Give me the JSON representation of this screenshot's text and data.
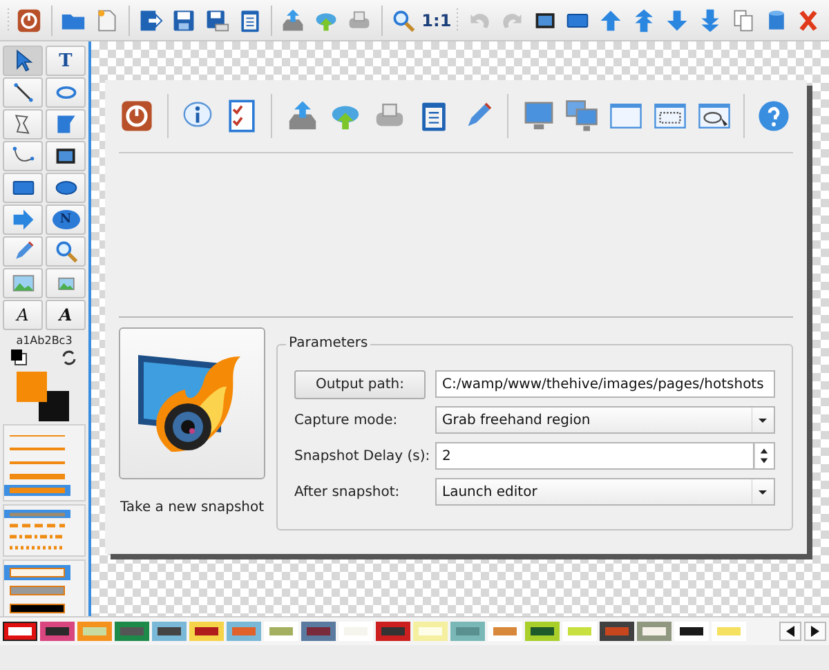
{
  "toolbar": [
    {
      "kind": "grip"
    },
    {
      "kind": "power"
    },
    {
      "kind": "separator"
    },
    {
      "kind": "folder"
    },
    {
      "kind": "new-doc"
    },
    {
      "kind": "separator"
    },
    {
      "kind": "export"
    },
    {
      "kind": "save"
    },
    {
      "kind": "save-as"
    },
    {
      "kind": "clipboard"
    },
    {
      "kind": "separator"
    },
    {
      "kind": "tray-upload"
    },
    {
      "kind": "cloud-upload"
    },
    {
      "kind": "printer"
    },
    {
      "kind": "separator"
    },
    {
      "kind": "zoom"
    },
    {
      "kind": "label",
      "label": "1:1"
    },
    {
      "kind": "grip"
    },
    {
      "kind": "undo",
      "disabled": true
    },
    {
      "kind": "redo",
      "disabled": true
    },
    {
      "kind": "crop"
    },
    {
      "kind": "rect"
    },
    {
      "kind": "up"
    },
    {
      "kind": "up-double"
    },
    {
      "kind": "down"
    },
    {
      "kind": "down-double"
    },
    {
      "kind": "copy"
    },
    {
      "kind": "cylinder"
    },
    {
      "kind": "close"
    }
  ],
  "tools": [
    {
      "kind": "pointer",
      "selected": true
    },
    {
      "kind": "text",
      "label": "T",
      "selected": false
    },
    {
      "kind": "line",
      "selected": false
    },
    {
      "kind": "lasso",
      "selected": false
    },
    {
      "kind": "polygon",
      "selected": false
    },
    {
      "kind": "region",
      "selected": false
    },
    {
      "kind": "curve",
      "selected": false
    },
    {
      "kind": "crop",
      "selected": false
    },
    {
      "kind": "rect",
      "selected": false
    },
    {
      "kind": "ellipse",
      "selected": false
    },
    {
      "kind": "arrow",
      "selected": false
    },
    {
      "kind": "number",
      "label": "N",
      "selected": false
    },
    {
      "kind": "pencil",
      "selected": false
    },
    {
      "kind": "zoom",
      "selected": false
    },
    {
      "kind": "image",
      "selected": false
    },
    {
      "kind": "image-small",
      "selected": false
    },
    {
      "kind": "font",
      "label": "A",
      "selected": false
    },
    {
      "kind": "font-bold",
      "label": "A",
      "selected": false
    }
  ],
  "font_sample": "a1Ab2Bc3",
  "color_slots": [
    {
      "kind": "primary",
      "color": "#f58a07"
    },
    {
      "kind": "secondary",
      "color": "#111111"
    }
  ],
  "line_widths": [
    {
      "selected": false
    },
    {
      "selected": false
    },
    {
      "selected": false
    },
    {
      "selected": false
    },
    {
      "selected": true
    }
  ],
  "line_styles": [
    {
      "kind": "solid",
      "selected": true
    },
    {
      "kind": "dash",
      "selected": false
    },
    {
      "kind": "dash-dot",
      "selected": false
    },
    {
      "kind": "dot",
      "selected": false
    }
  ],
  "fill_styles": [
    {
      "color": "#fbf4e6",
      "selected": true
    },
    {
      "color": "#999999",
      "selected": false
    },
    {
      "color": "#000000",
      "selected": false
    }
  ],
  "dialog": {
    "toolbar": [
      {
        "kind": "power"
      },
      {
        "kind": "separator"
      },
      {
        "kind": "info"
      },
      {
        "kind": "checklist"
      },
      {
        "kind": "separator"
      },
      {
        "kind": "tray-upload"
      },
      {
        "kind": "cloud-upload"
      },
      {
        "kind": "printer"
      },
      {
        "kind": "clipboard"
      },
      {
        "kind": "pencil"
      },
      {
        "kind": "separator"
      },
      {
        "kind": "monitor"
      },
      {
        "kind": "monitors"
      },
      {
        "kind": "window"
      },
      {
        "kind": "window-dashed"
      },
      {
        "kind": "window-cursor"
      },
      {
        "kind": "separator"
      },
      {
        "kind": "help"
      }
    ],
    "snapshot_caption": "Take a new snapshot",
    "group_title": "Parameters",
    "fields": [
      {
        "kind": "button",
        "label": "Output path:",
        "value": "C:/wamp/www/thehive/images/pages/hotshots"
      },
      {
        "kind": "select",
        "label": "Capture mode:",
        "value": "Grab freehand region"
      },
      {
        "kind": "spin",
        "label": "Snapshot Delay (s):",
        "value": "2"
      },
      {
        "kind": "select",
        "label": "After snapshot:",
        "value": "Launch editor"
      }
    ]
  },
  "palette": [
    {
      "color": "#ffffff",
      "frame": {
        "color": "#e01010"
      },
      "selected": true
    },
    {
      "color": "#2a2a2a",
      "frame": {
        "color": "#d9457f"
      },
      "selected": false
    },
    {
      "color": "#c8dba0",
      "frame": {
        "color": "#f5921e"
      },
      "selected": false
    },
    {
      "color": "#555555",
      "frame": {
        "color": "#1e8a4a"
      },
      "selected": false
    },
    {
      "color": "#444444",
      "frame": {
        "color": "#7ab8d8"
      },
      "selected": false
    },
    {
      "color": "#b01c1c",
      "frame": {
        "color": "#f5d44a"
      },
      "selected": false
    },
    {
      "color": "#e0622a",
      "frame": {
        "color": "#7ab8d8"
      },
      "selected": false
    },
    {
      "color": "#a4b060",
      "frame": {
        "color": "#ffffff"
      },
      "selected": false
    },
    {
      "color": "#7a2a3a",
      "frame": {
        "color": "#5a7aa0"
      },
      "selected": false
    },
    {
      "color": "#f5f5ee",
      "frame": {
        "color": "#ffffff"
      },
      "selected": false
    },
    {
      "color": "#333333",
      "frame": {
        "color": "#cc1f1f"
      },
      "selected": false
    },
    {
      "color": "#fdfde8",
      "frame": {
        "color": "#f5f0a0"
      },
      "selected": false
    },
    {
      "color": "#5a9090",
      "frame": {
        "color": "#7ab8b8"
      },
      "selected": false
    },
    {
      "color": "#d8883a",
      "frame": {
        "color": "#ffffff"
      },
      "selected": false
    },
    {
      "color": "#1e5a2a",
      "frame": {
        "color": "#a8cf2a"
      },
      "selected": false
    },
    {
      "color": "#c8e040",
      "frame": {
        "color": "#ffffff"
      },
      "selected": false
    },
    {
      "color": "#c8461e",
      "frame": {
        "color": "#404040"
      },
      "selected": false
    },
    {
      "color": "#f5f0e8",
      "frame": {
        "color": "#909880"
      },
      "selected": false
    },
    {
      "color": "#1a1a1a",
      "frame": {
        "color": "#ffffff"
      },
      "selected": false
    },
    {
      "color": "#f5e060",
      "frame": {
        "color": "#ffffff"
      },
      "selected": false
    }
  ]
}
